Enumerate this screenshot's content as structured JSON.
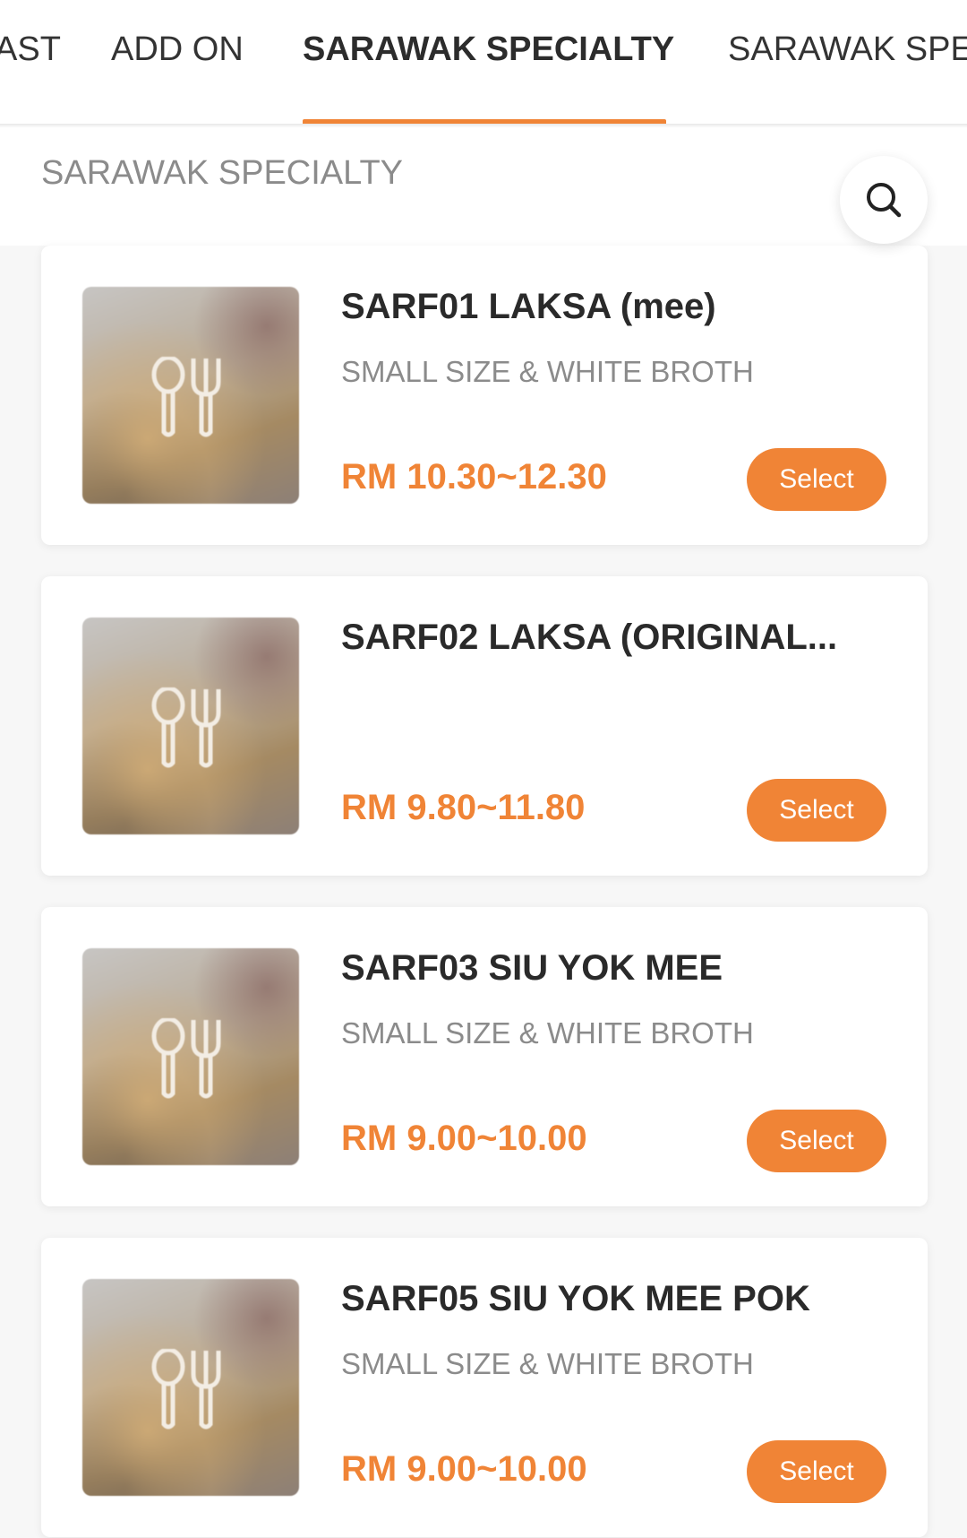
{
  "tabs": [
    {
      "label": "AST",
      "active": false
    },
    {
      "label": "ADD ON",
      "active": false
    },
    {
      "label": "SARAWAK SPECIALTY",
      "active": true
    },
    {
      "label": "SARAWAK SPE",
      "active": false
    }
  ],
  "section": {
    "title": "SARAWAK SPECIALTY",
    "search_icon": "search-icon"
  },
  "items": [
    {
      "name": "SARF01 LAKSA (mee)",
      "description": "SMALL SIZE & WHITE BROTH",
      "price": "RM 10.30~12.30",
      "button": "Select"
    },
    {
      "name": "SARF02 LAKSA (ORIGINAL...",
      "description": "",
      "price": "RM 9.80~11.80",
      "button": "Select"
    },
    {
      "name": "SARF03 SIU YOK MEE",
      "description": "SMALL SIZE & WHITE BROTH",
      "price": "RM 9.00~10.00",
      "button": "Select"
    },
    {
      "name": "SARF05 SIU YOK MEE POK",
      "description": "SMALL SIZE & WHITE BROTH",
      "price": "RM 9.00~10.00",
      "button": "Select"
    }
  ],
  "colors": {
    "accent": "#f08436",
    "text_dark": "#2a2a2a",
    "text_muted": "#8b8b8b"
  }
}
